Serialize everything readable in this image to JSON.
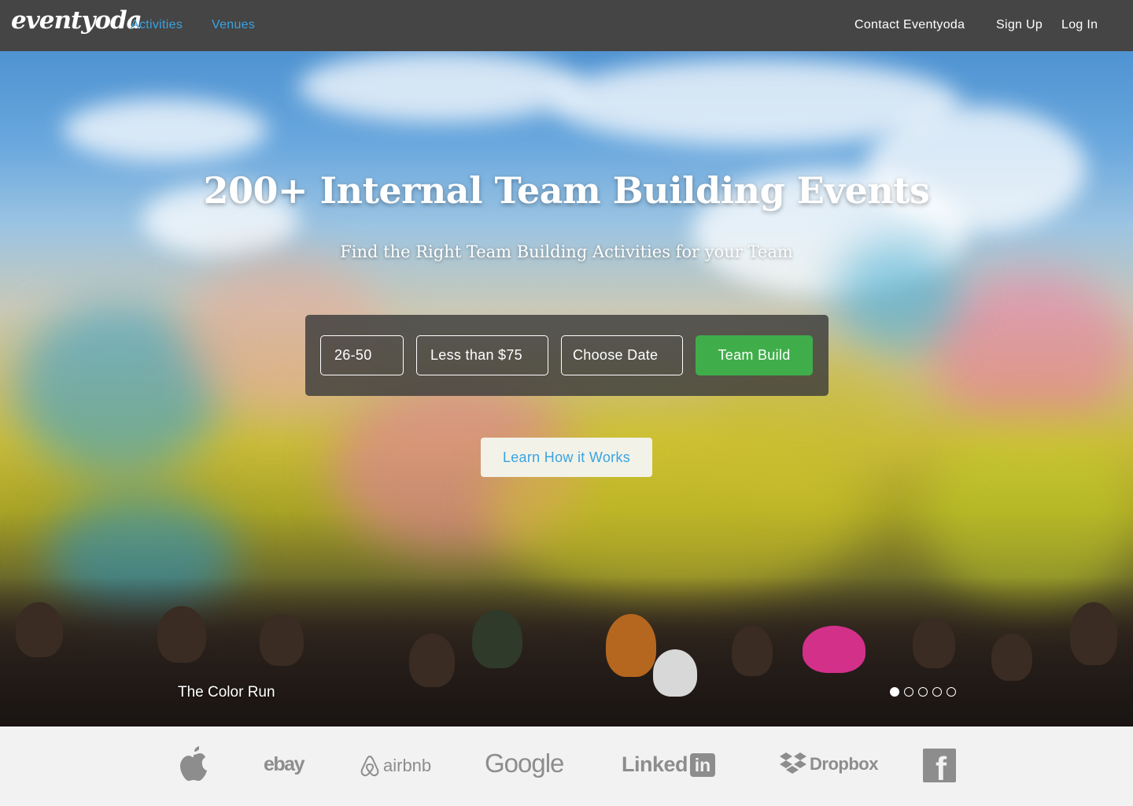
{
  "nav": {
    "brand": "eventyoda",
    "links": [
      "Activities",
      "Venues"
    ],
    "right": [
      "Contact Eventyoda",
      "Sign Up",
      "Log In"
    ]
  },
  "hero": {
    "title": "200+ Internal Team Building Events",
    "subtitle": "Find the Right Team Building Activities for your Team",
    "filters": {
      "group_size": "26-50",
      "budget": "Less than $75",
      "date": "Choose Date",
      "submit": "Team Build"
    },
    "learn_button": "Learn How it Works",
    "caption": "The Color Run",
    "slides": {
      "count": 5,
      "active": 1
    }
  },
  "logos": [
    "apple",
    "ebay",
    "airbnb",
    "Google",
    "LinkedIn",
    "Dropbox",
    "facebook"
  ],
  "logo_text": {
    "ebay": "ebay",
    "airbnb": "airbnb",
    "google": "Google",
    "linkedin": "Linked",
    "linkedin_box": "in",
    "dropbox": "Dropbox",
    "facebook": "f"
  },
  "colors": {
    "nav_bg": "#454545",
    "link": "#3aa3e0",
    "accent_green": "#3fae4a",
    "logo_gray": "#8d8d8d"
  }
}
